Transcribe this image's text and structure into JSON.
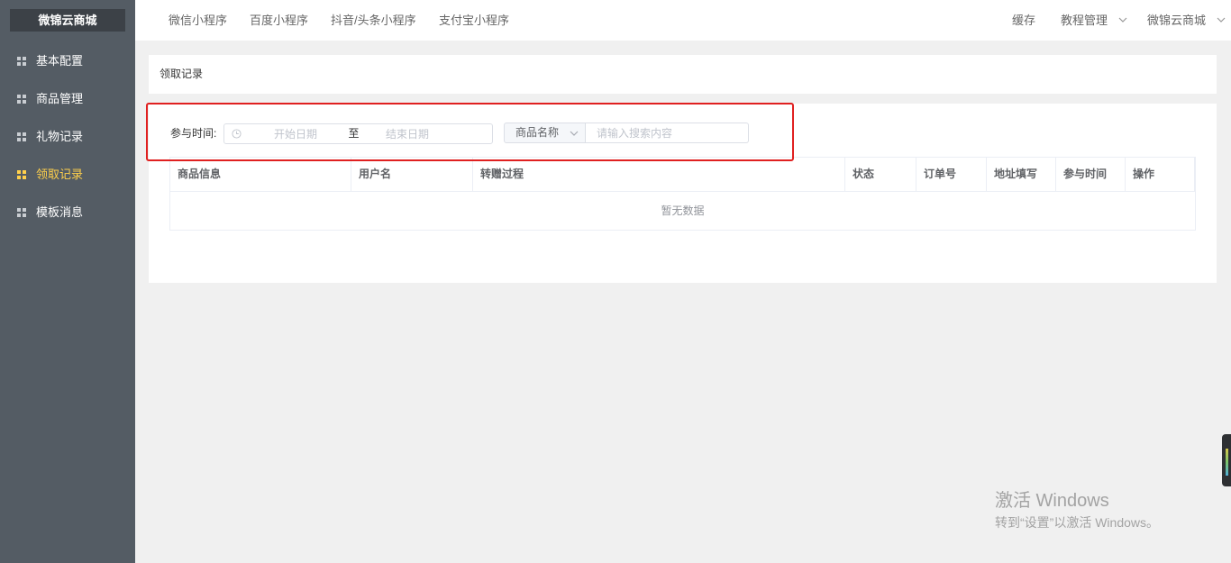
{
  "sidebar": {
    "logo": "微锦云商城",
    "items": [
      {
        "label": "基本配置",
        "icon": "grid-icon",
        "active": false
      },
      {
        "label": "商品管理",
        "icon": "grid-icon",
        "active": false
      },
      {
        "label": "礼物记录",
        "icon": "grid-icon",
        "active": false
      },
      {
        "label": "领取记录",
        "icon": "grid-icon",
        "active": true
      },
      {
        "label": "模板消息",
        "icon": "grid-icon",
        "active": false
      }
    ]
  },
  "header": {
    "nav": [
      "微信小程序",
      "百度小程序",
      "抖音/头条小程序",
      "支付宝小程序"
    ],
    "cache": "缓存",
    "tutorial_menu": {
      "label": "教程管理",
      "icon": "chevron-down-icon"
    },
    "account_menu": {
      "label": "微锦云商城",
      "icon": "chevron-down-icon"
    }
  },
  "page": {
    "title": "领取记录"
  },
  "filter": {
    "time_label": "参与时间:",
    "date_range": {
      "icon": "clock-icon",
      "start_placeholder": "开始日期",
      "separator": "至",
      "end_placeholder": "结束日期"
    },
    "field_select": {
      "value": "商品名称",
      "icon": "chevron-down-icon"
    },
    "search_placeholder": "请输入搜索内容"
  },
  "table": {
    "columns": [
      "商品信息",
      "用户名",
      "转赠过程",
      "状态",
      "订单号",
      "地址填写",
      "参与时间",
      "操作"
    ],
    "rows": [],
    "empty_text": "暂无数据"
  },
  "watermark": {
    "title": "激活 Windows",
    "subtitle": "转到“设置”以激活 Windows。"
  },
  "colors": {
    "sidebar_bg": "#545c64",
    "logo_bg": "#3c4147",
    "active_text": "#ffd04b",
    "main_bg": "#f0f0f0",
    "highlight": "#e02020"
  }
}
